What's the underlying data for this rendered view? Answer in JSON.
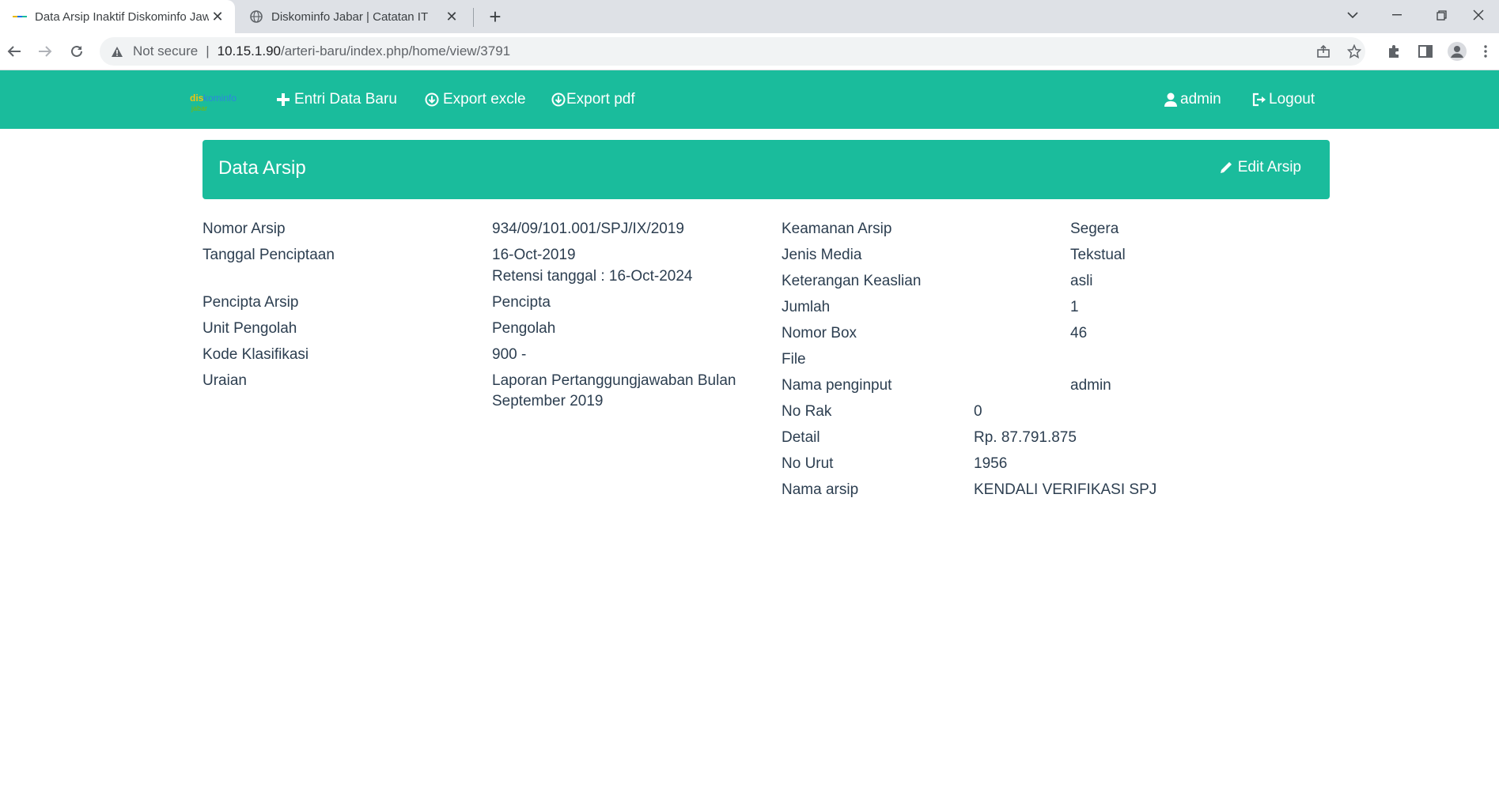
{
  "browser": {
    "tabs": [
      {
        "title": "Data Arsip Inaktif Diskominfo Jawa Barat",
        "active": true
      },
      {
        "title": "Diskominfo Jabar | Catatan IT",
        "active": false
      }
    ],
    "security_label": "Not secure",
    "url_host": "10.15.1.90",
    "url_path": "/arteri-baru/index.php/home/view/3791"
  },
  "nav": {
    "logo_text_a": "dis",
    "logo_text_b": "kominfo",
    "logo_text_c": "jabar",
    "entri": "Entri Data Baru",
    "export_excel": "Export excle",
    "export_pdf": "Export pdf",
    "user": "admin",
    "logout": "Logout"
  },
  "panel": {
    "title": "Data Arsip",
    "edit_label": "Edit Arsip"
  },
  "left_fields": [
    {
      "label": "Nomor Arsip",
      "value": "934/09/101.001/SPJ/IX/2019"
    },
    {
      "label": "Tanggal Penciptaan",
      "value": "16-Oct-2019",
      "value2": "Retensi tanggal : 16-Oct-2024"
    },
    {
      "label": "Pencipta Arsip",
      "value": "Pencipta"
    },
    {
      "label": "Unit Pengolah",
      "value": "Pengolah"
    },
    {
      "label": "Kode Klasifikasi",
      "value": "900 -"
    },
    {
      "label": "Uraian",
      "value": "Laporan Pertanggungjawaban Bulan September 2019"
    }
  ],
  "right_fields": [
    {
      "label": "Keamanan Arsip",
      "value": "Segera"
    },
    {
      "label": "Jenis Media",
      "value": "Tekstual"
    },
    {
      "label": "Keterangan Keaslian",
      "value": "asli"
    },
    {
      "label": "Jumlah",
      "value": "1"
    },
    {
      "label": "Nomor Box",
      "value": "46"
    },
    {
      "label": "File",
      "value": ""
    },
    {
      "label": "Nama penginput",
      "value": "admin"
    },
    {
      "label": "No Rak",
      "value": "0"
    },
    {
      "label": "Detail",
      "value": "Rp. 87.791.875"
    },
    {
      "label": "No Urut",
      "value": "1956"
    },
    {
      "label": "Nama arsip",
      "value": "KENDALI VERIFIKASI SPJ"
    }
  ],
  "colors": {
    "accent": "#1abc9c",
    "text": "#2c3e50"
  }
}
